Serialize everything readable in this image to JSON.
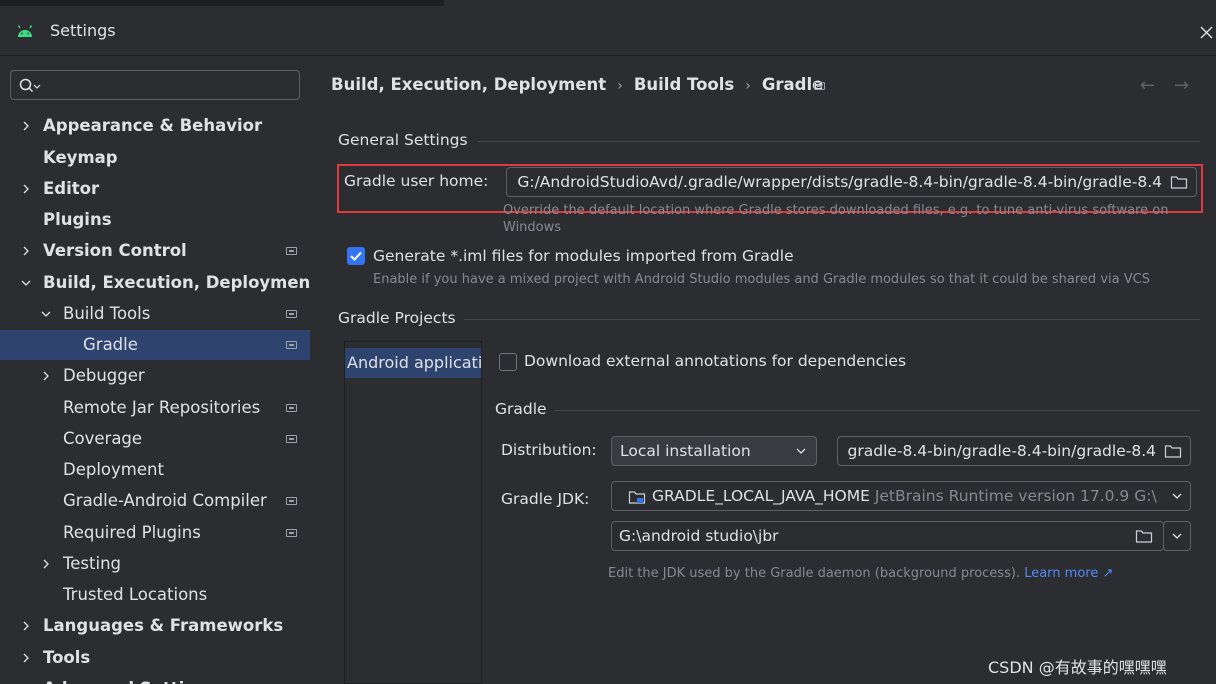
{
  "window": {
    "title": "Settings"
  },
  "search": {
    "placeholder": ""
  },
  "sidebar": {
    "items": [
      {
        "label": "Appearance & Behavior"
      },
      {
        "label": "Keymap"
      },
      {
        "label": "Editor"
      },
      {
        "label": "Plugins"
      },
      {
        "label": "Version Control"
      },
      {
        "label": "Build, Execution, Deployment"
      },
      {
        "label": "Build Tools"
      },
      {
        "label": "Gradle"
      },
      {
        "label": "Debugger"
      },
      {
        "label": "Remote Jar Repositories"
      },
      {
        "label": "Coverage"
      },
      {
        "label": "Deployment"
      },
      {
        "label": "Gradle-Android Compiler"
      },
      {
        "label": "Required Plugins"
      },
      {
        "label": "Testing"
      },
      {
        "label": "Trusted Locations"
      },
      {
        "label": "Languages & Frameworks"
      },
      {
        "label": "Tools"
      },
      {
        "label": "Advanced Settings"
      }
    ]
  },
  "breadcrumb": {
    "part1": "Build, Execution, Deployment",
    "part2": "Build Tools",
    "part3": "Gradle",
    "sep": "›"
  },
  "nav": {
    "back": "←",
    "forward": "→"
  },
  "general": {
    "section_title": "General Settings",
    "user_home_label": "Gradle user home:",
    "user_home_value": "G:/AndroidStudioAvd/.gradle/wrapper/dists/gradle-8.4-bin/gradle-8.4-bin/gradle-8.4",
    "user_home_hint_line1": "Override the default location where Gradle stores downloaded files, e.g. to tune anti-virus software on",
    "user_home_hint_line2": "Windows",
    "iml_label": "Generate *.iml files for modules imported from Gradle",
    "iml_checked": true,
    "iml_hint": "Enable if you have a mixed project with Android Studio modules and Gradle modules so that it could be shared via VCS"
  },
  "projects": {
    "section_title": "Gradle Projects",
    "list": [
      {
        "label": "Android application"
      }
    ],
    "download_annotations_label": "Download external annotations for dependencies",
    "download_annotations_checked": false,
    "gradle_section_title": "Gradle",
    "distribution_label": "Distribution:",
    "distribution_value": "Local installation",
    "distribution_path": "gradle-8.4-bin/gradle-8.4-bin/gradle-8.4",
    "jdk_label": "Gradle JDK:",
    "jdk_name": "GRADLE_LOCAL_JAVA_HOME",
    "jdk_detail": "JetBrains Runtime version 17.0.9 G:\\",
    "jdk_path": "G:\\android studio\\jbr",
    "jdk_hint": "Edit the JDK used by the Gradle daemon (background process).",
    "learn_more": "Learn more ↗"
  },
  "watermark": {
    "text": "CSDN @有故事的嘿嘿嘿"
  },
  "colors": {
    "accent": "#3574f0",
    "selection": "#2e436e",
    "highlight_border": "#e0393e",
    "link": "#548af7",
    "android_green": "#3ddc84"
  }
}
